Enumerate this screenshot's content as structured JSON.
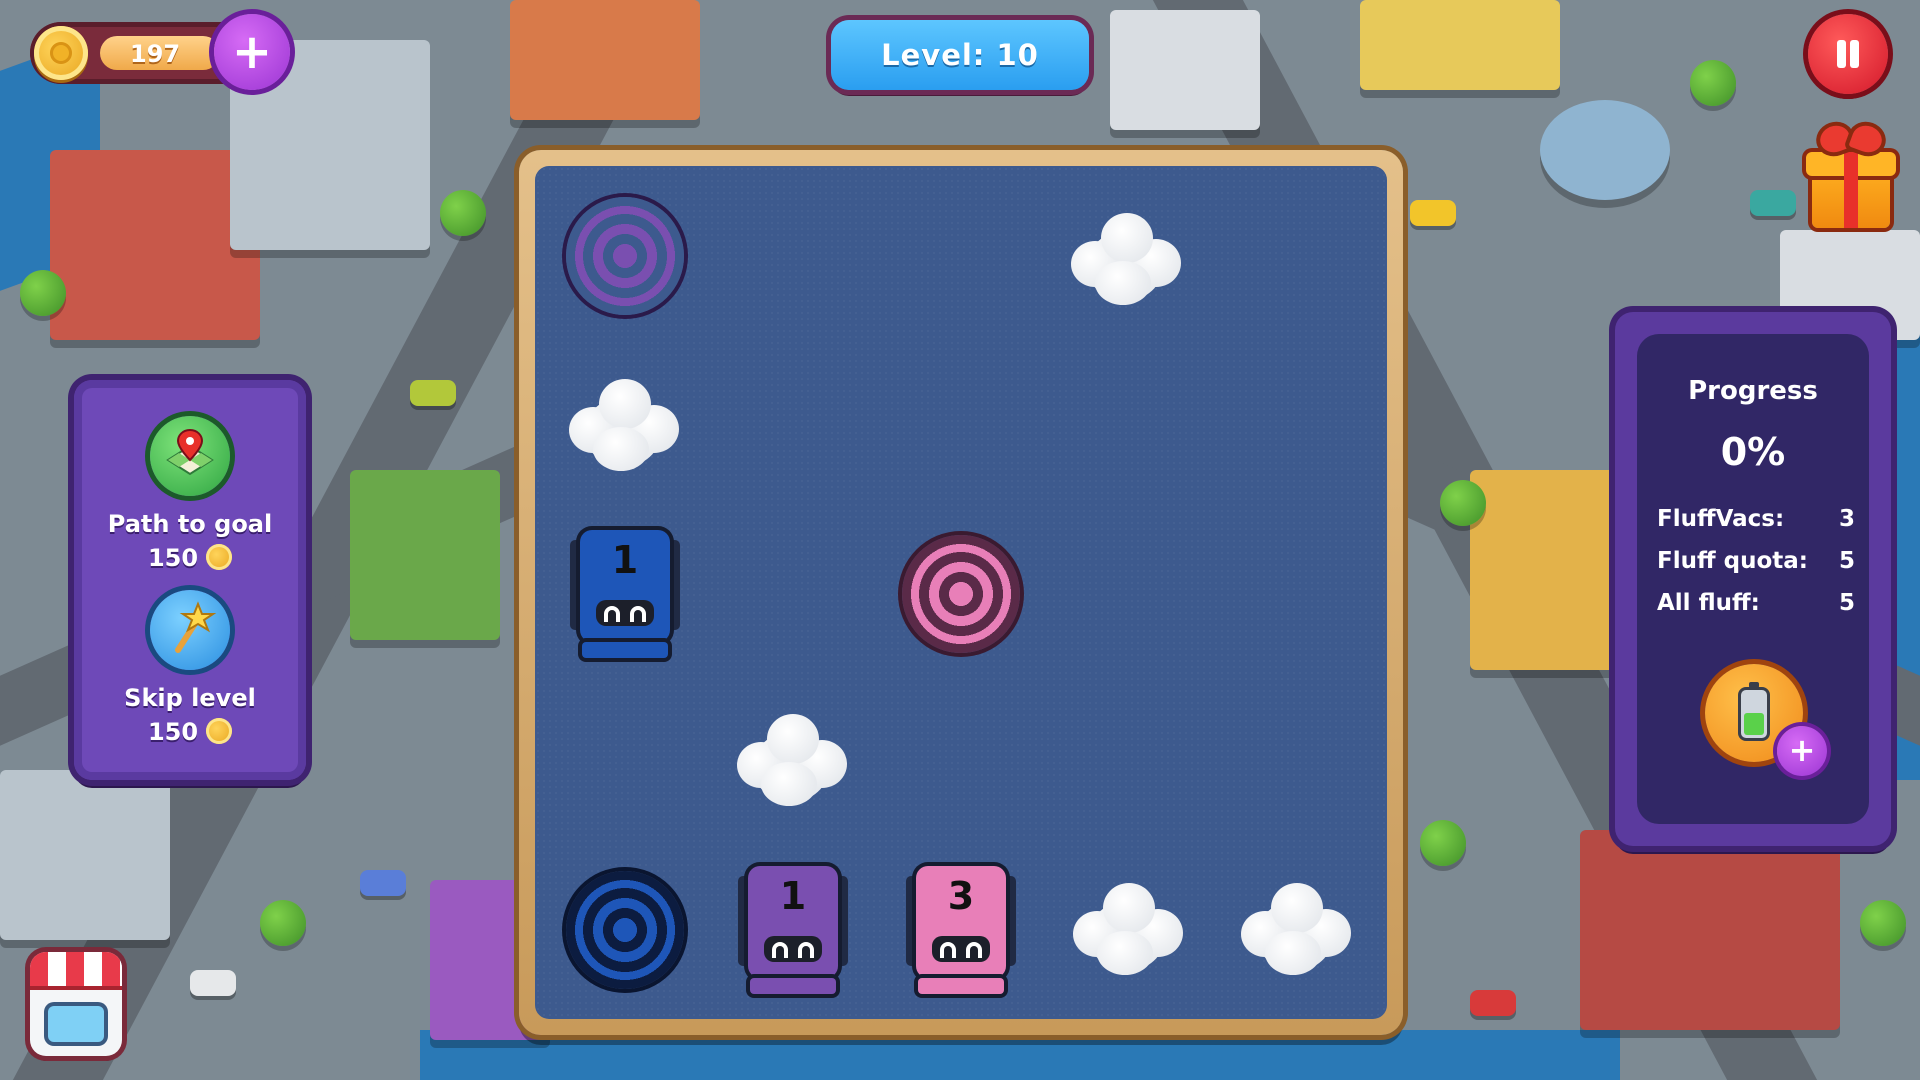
{
  "hud": {
    "coins": "197",
    "level_label": "Level: 10"
  },
  "powerups": [
    {
      "label": "Path to goal",
      "cost": "150",
      "icon": "map-pin-icon"
    },
    {
      "label": "Skip level",
      "cost": "150",
      "icon": "magic-wand-icon"
    }
  ],
  "progress": {
    "title": "Progress",
    "percent": "0%",
    "stats": [
      {
        "label": "FluffVacs:",
        "value": "3"
      },
      {
        "label": "Fluff quota:",
        "value": "5"
      },
      {
        "label": "All fluff:",
        "value": "5"
      }
    ]
  },
  "board": {
    "robots": [
      {
        "number": "1",
        "color": "#1e56b8"
      },
      {
        "number": "1",
        "color": "#7a4fb0"
      },
      {
        "number": "3",
        "color": "#e87fb8"
      }
    ],
    "target_colors": [
      "#7a4fb0",
      "#e87fb8",
      "#1e56b8"
    ]
  }
}
